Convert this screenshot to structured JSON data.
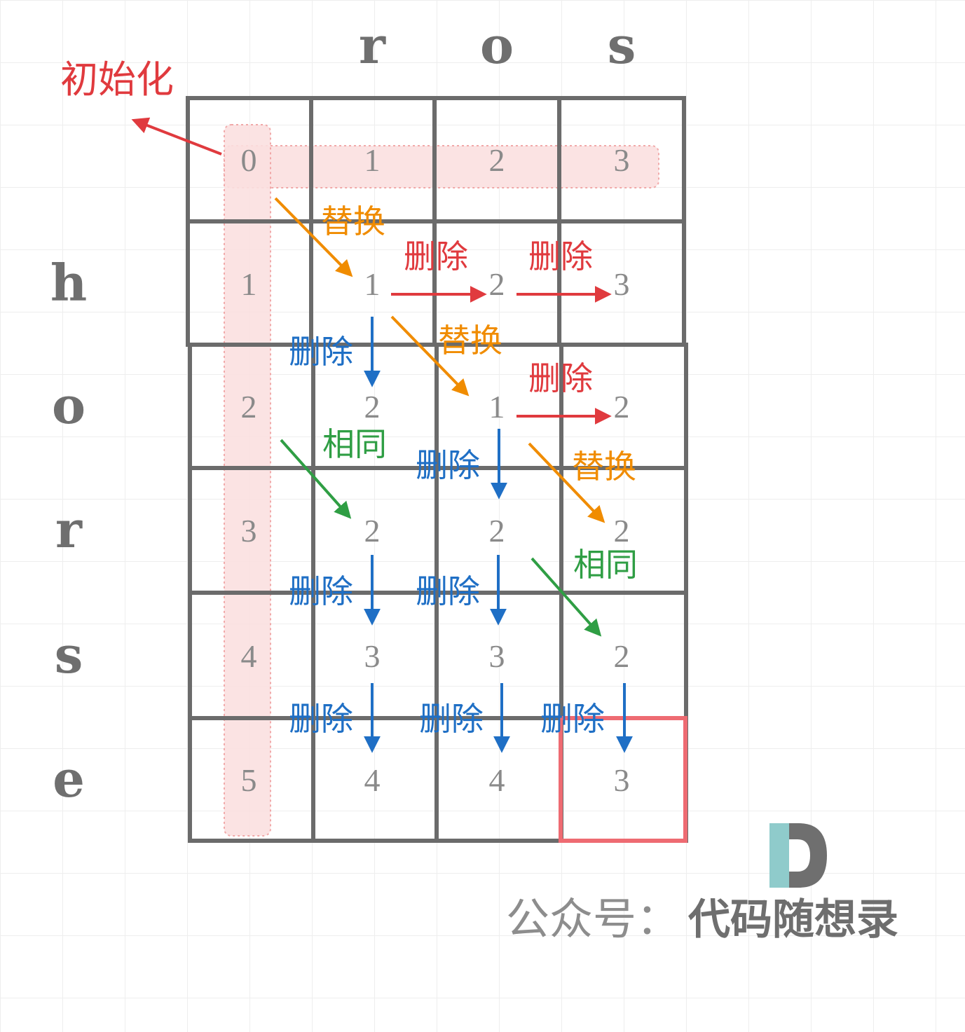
{
  "diagram": {
    "word_top": [
      "r",
      "o",
      "s"
    ],
    "word_left": [
      "h",
      "o",
      "r",
      "s",
      "e"
    ],
    "dp": [
      [
        "0",
        "1",
        "2",
        "3"
      ],
      [
        "1",
        "1",
        "2",
        "3"
      ],
      [
        "2",
        "2",
        "1",
        "2"
      ],
      [
        "3",
        "2",
        "2",
        "2"
      ],
      [
        "4",
        "3",
        "3",
        "2"
      ],
      [
        "5",
        "4",
        "4",
        "3"
      ]
    ],
    "labels": {
      "init": "初始化",
      "replace": "替换",
      "delete": "删除",
      "same": "相同"
    },
    "colors": {
      "init": "#e03a3e",
      "replace": "#f08c00",
      "delete_h": "#e03a3e",
      "delete_v": "#1f6fc5",
      "same": "#2f9e44",
      "highlight": "#fbe0e0",
      "result_border": "#ee6b72"
    },
    "watermark": {
      "prefix": "公众号：",
      "name": "代码随想录",
      "logo_letter": "D"
    }
  }
}
